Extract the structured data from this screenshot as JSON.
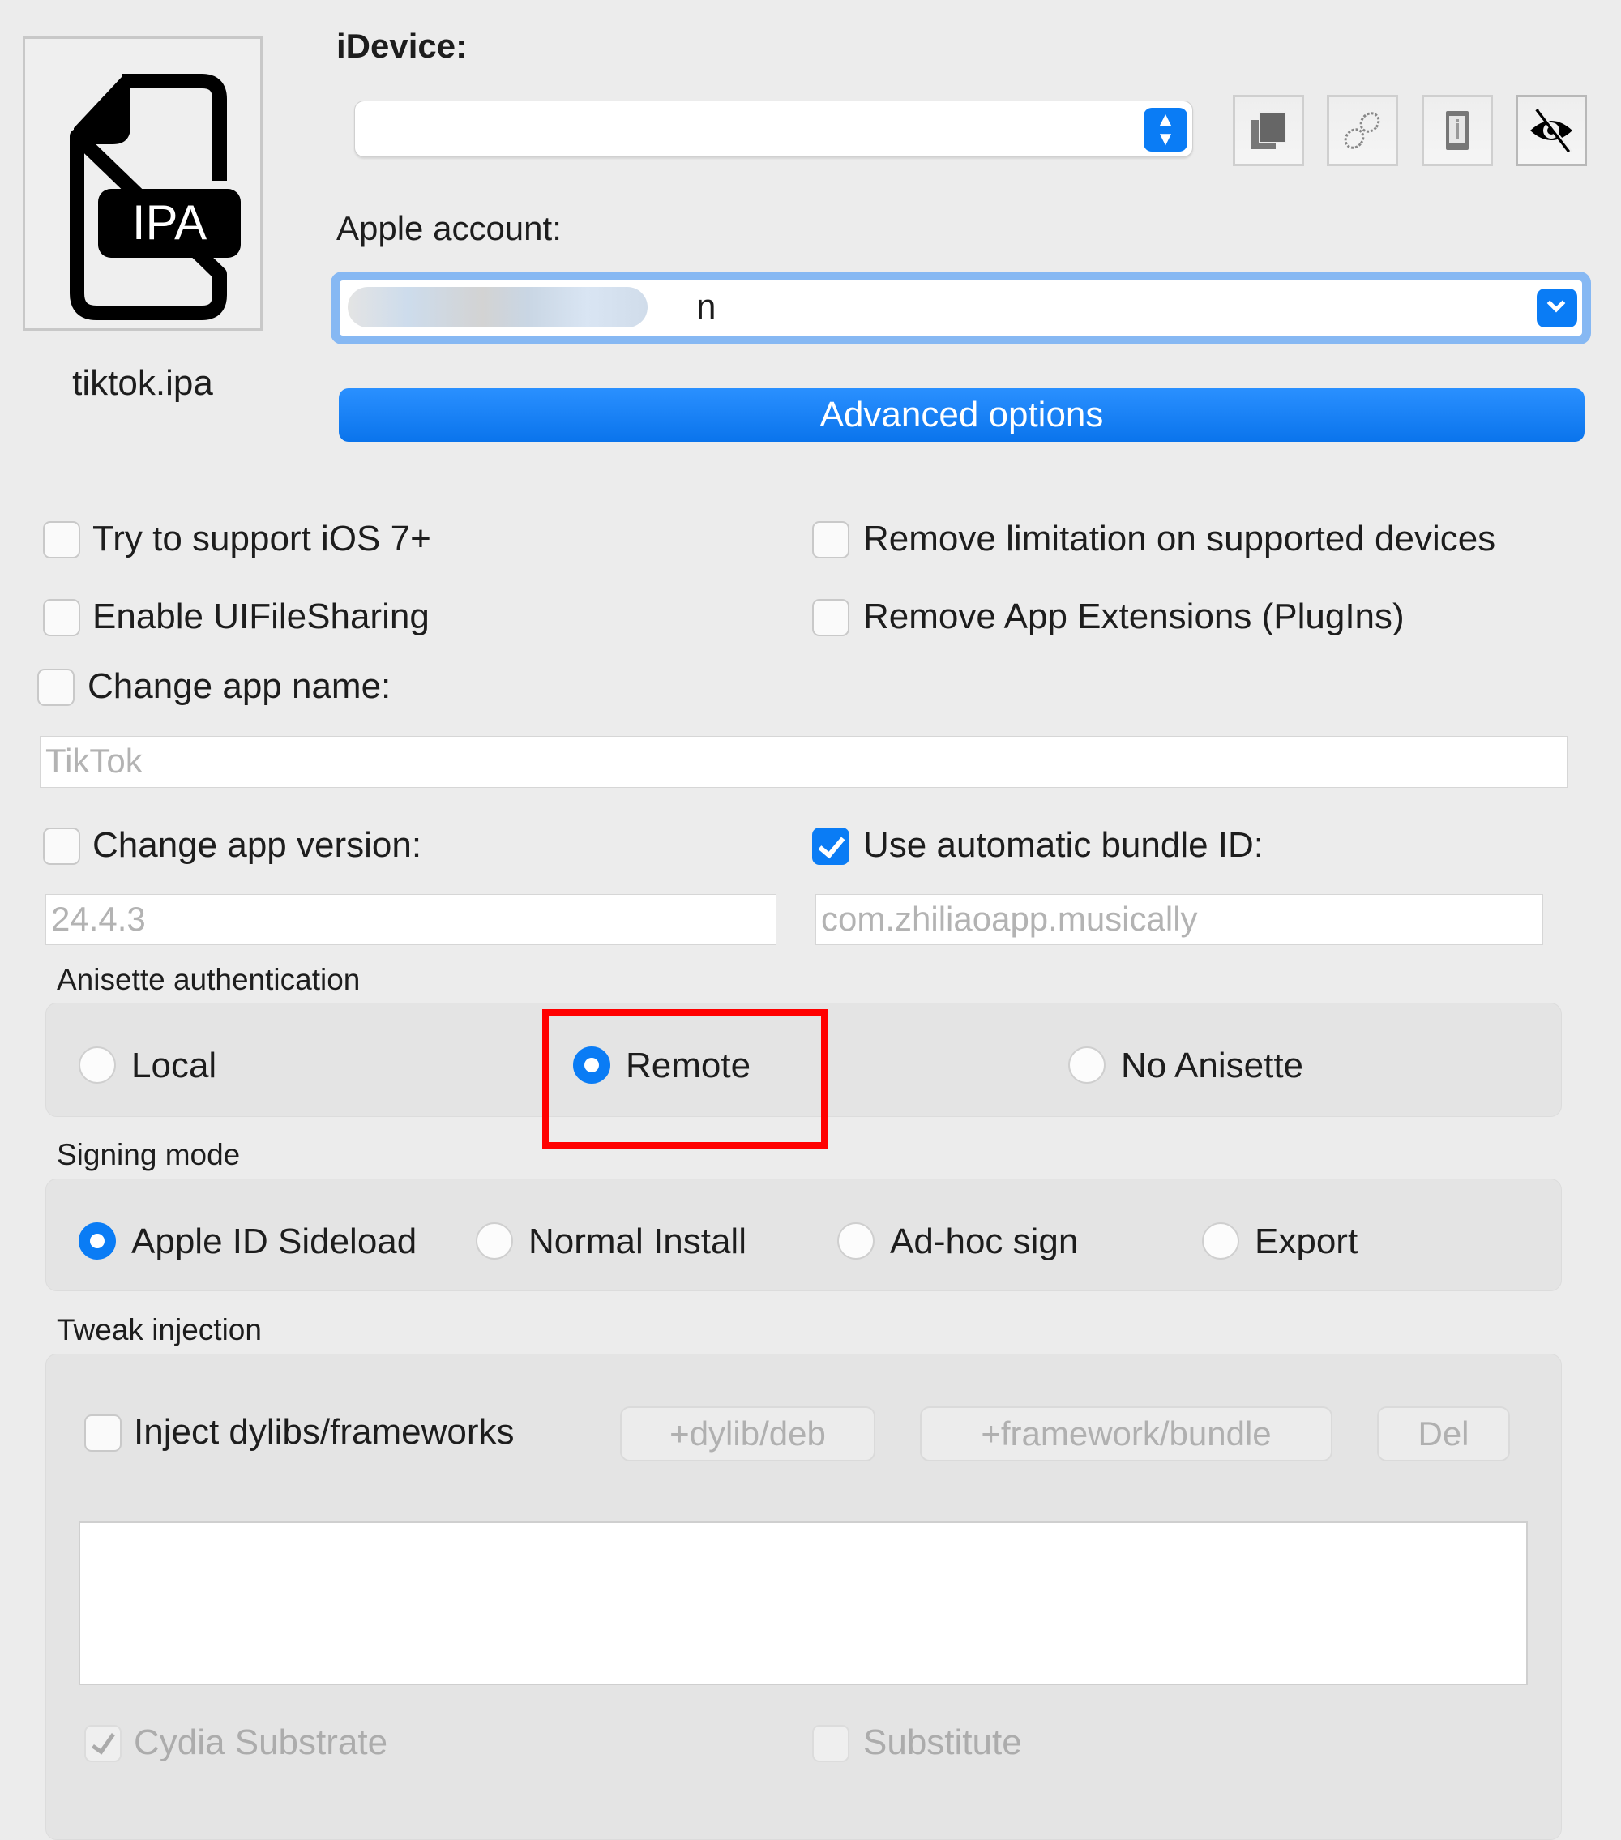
{
  "file": {
    "name": "tiktok.ipa",
    "icon": "ipa-file-icon",
    "icon_text": "IPA"
  },
  "device": {
    "label": "iDevice:",
    "value": ""
  },
  "toolbar_icons": [
    "copy-icon",
    "unlink-icon",
    "device-info-icon",
    "eye-slash-icon"
  ],
  "account": {
    "label": "Apple account:",
    "visible_suffix": "n",
    "redacted": true
  },
  "advanced_label": "Advanced options",
  "options": {
    "ios7": {
      "label": "Try to support iOS 7+",
      "checked": false
    },
    "remove_limit": {
      "label": "Remove limitation on supported devices",
      "checked": false
    },
    "filesharing": {
      "label": "Enable UIFileSharing",
      "checked": false
    },
    "remove_ext": {
      "label": "Remove App Extensions (PlugIns)",
      "checked": false
    },
    "app_name": {
      "label": "Change app name:",
      "checked": false,
      "placeholder": "TikTok"
    },
    "app_version": {
      "label": "Change app version:",
      "checked": false,
      "placeholder": "24.4.3"
    },
    "bundle": {
      "label": "Use automatic bundle ID:",
      "checked": true,
      "placeholder": "com.zhiliaoapp.musically"
    }
  },
  "anisette": {
    "label": "Anisette authentication",
    "options": [
      "Local",
      "Remote",
      "No Anisette"
    ],
    "selected": "Remote",
    "highlight_color": "#ff0000"
  },
  "signing": {
    "label": "Signing mode",
    "options": [
      "Apple ID Sideload",
      "Normal Install",
      "Ad-hoc sign",
      "Export"
    ],
    "selected": "Apple ID Sideload"
  },
  "tweak": {
    "label": "Tweak injection",
    "inject_label": "Inject dylibs/frameworks",
    "buttons": [
      "+dylib/deb",
      "+framework/bundle",
      "Del"
    ],
    "cydia": "Cydia Substrate",
    "cydia_checked": true,
    "substitute": "Substitute",
    "substitute_checked": false
  },
  "colors": {
    "accent": "#0a7cf5"
  }
}
